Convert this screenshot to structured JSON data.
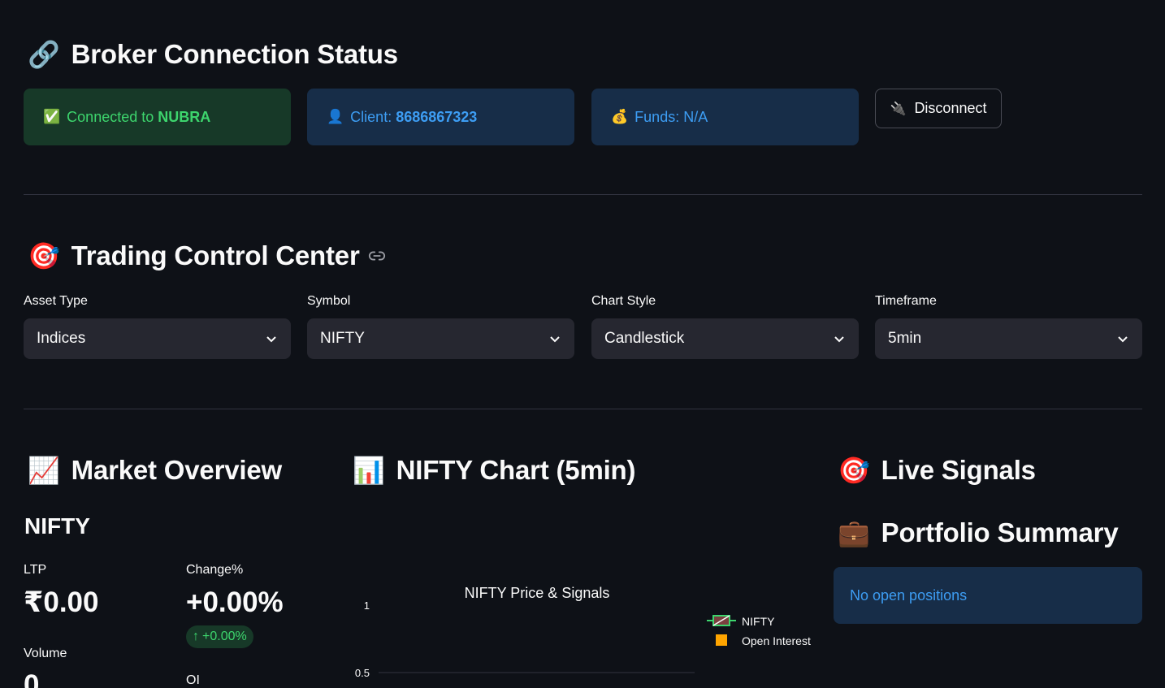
{
  "broker": {
    "title": "Broker Connection Status",
    "title_icon": "link-icon",
    "connected_prefix": "Connected to ",
    "connected_broker": "NUBRA",
    "client_prefix": "Client: ",
    "client_id": "8686867323",
    "funds_text": "Funds: N/A",
    "disconnect_label": "Disconnect"
  },
  "control": {
    "title": "Trading Control Center",
    "title_icon": "target-icon",
    "selects": [
      {
        "label": "Asset Type",
        "value": "Indices"
      },
      {
        "label": "Symbol",
        "value": "NIFTY"
      },
      {
        "label": "Chart Style",
        "value": "Candlestick"
      },
      {
        "label": "Timeframe",
        "value": "5min"
      }
    ]
  },
  "market": {
    "title": "Market Overview",
    "symbol": "NIFTY",
    "ltp_label": "LTP",
    "ltp_value": "₹0.00",
    "change_label": "Change%",
    "change_value": "+0.00%",
    "change_delta": "+0.00%",
    "volume_label": "Volume",
    "volume_value": "0",
    "oi_label": "OI"
  },
  "chart_section": {
    "title": "NIFTY Chart (5min)"
  },
  "signals": {
    "title": "Live Signals"
  },
  "portfolio": {
    "title": "Portfolio Summary",
    "empty_text": "No open positions"
  },
  "colors": {
    "background": "#0e1117",
    "success_bg": "#173928",
    "success_text": "#3dd56d",
    "info_bg": "#172d48",
    "info_text": "#3d9df3",
    "open_interest": "#ffa500",
    "nifty_increasing": "#3dd56d",
    "nifty_decreasing": "#ff4b4b"
  },
  "chart_data": {
    "type": "candlestick",
    "title": "NIFTY Price & Signals",
    "y_ticks": [
      "1",
      "0.5"
    ],
    "legend": [
      "NIFTY",
      "Open Interest"
    ],
    "legend_position": "right",
    "series": [
      {
        "name": "NIFTY",
        "values": []
      },
      {
        "name": "Open Interest",
        "values": []
      }
    ]
  }
}
